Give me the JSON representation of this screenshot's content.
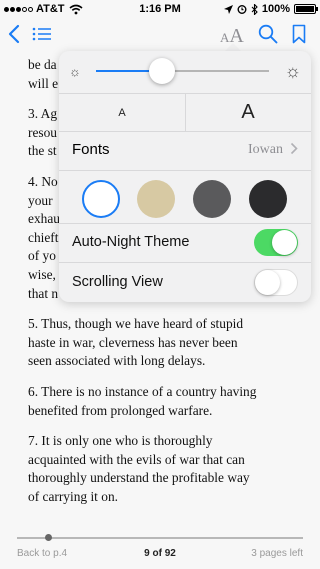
{
  "status_bar": {
    "carrier": "AT&T",
    "time": "1:16 PM",
    "battery_percent": "100%",
    "battery_level": 1.0
  },
  "toolbar": {
    "font_small_glyph": "A",
    "font_large_glyph": "A"
  },
  "reader": {
    "paragraphs": [
      "be da… will e…",
      "3. Ag… resou… the st…",
      "4. No… your… exhau… chieft… of yo… wise,… that n…",
      "5. Thus, though we have heard of stupid haste in war, cleverness has never been seen associated with long delays.",
      "6. There is no instance of a country having benefited from prolonged warfare.",
      "7. It is only one who is thoroughly acquainted with the evils of war that can thoroughly understand the profitable way of carrying it on."
    ],
    "lines": [
      "be da",
      "will e",
      "3. Ag",
      "resou",
      "the st",
      "4. No",
      "your",
      "exhau",
      "chieft",
      "of yo",
      "wise,",
      "that n",
      "5. Thus, though we have heard of stupid",
      "haste in war, cleverness has never been",
      "seen associated with long delays.",
      "6. There is no instance of a country having",
      "benefited from prolonged warfare.",
      "7. It is only one who is thoroughly",
      "acquainted with the evils of war that can",
      "thoroughly understand the profitable way",
      "of carrying it on."
    ]
  },
  "popover": {
    "brightness_level": 0.38,
    "size_small_label": "A",
    "size_large_label": "A",
    "fonts_label": "Fonts",
    "fonts_value": "Iowan",
    "theme_colors": [
      "#ffffff",
      "#d7c9a3",
      "#5a5a5c",
      "#2b2b2d"
    ],
    "selected_theme_index": 0,
    "auto_night_label": "Auto-Night Theme",
    "auto_night_on": true,
    "scrolling_label": "Scrolling View",
    "scrolling_on": false
  },
  "footer": {
    "back_label": "Back to p.4",
    "page_label": "9 of 92",
    "pages_left_label": "3 pages left",
    "progress_fraction": 0.11
  },
  "colors": {
    "accent": "#1a7cf5",
    "toggle_on": "#4cd964"
  }
}
